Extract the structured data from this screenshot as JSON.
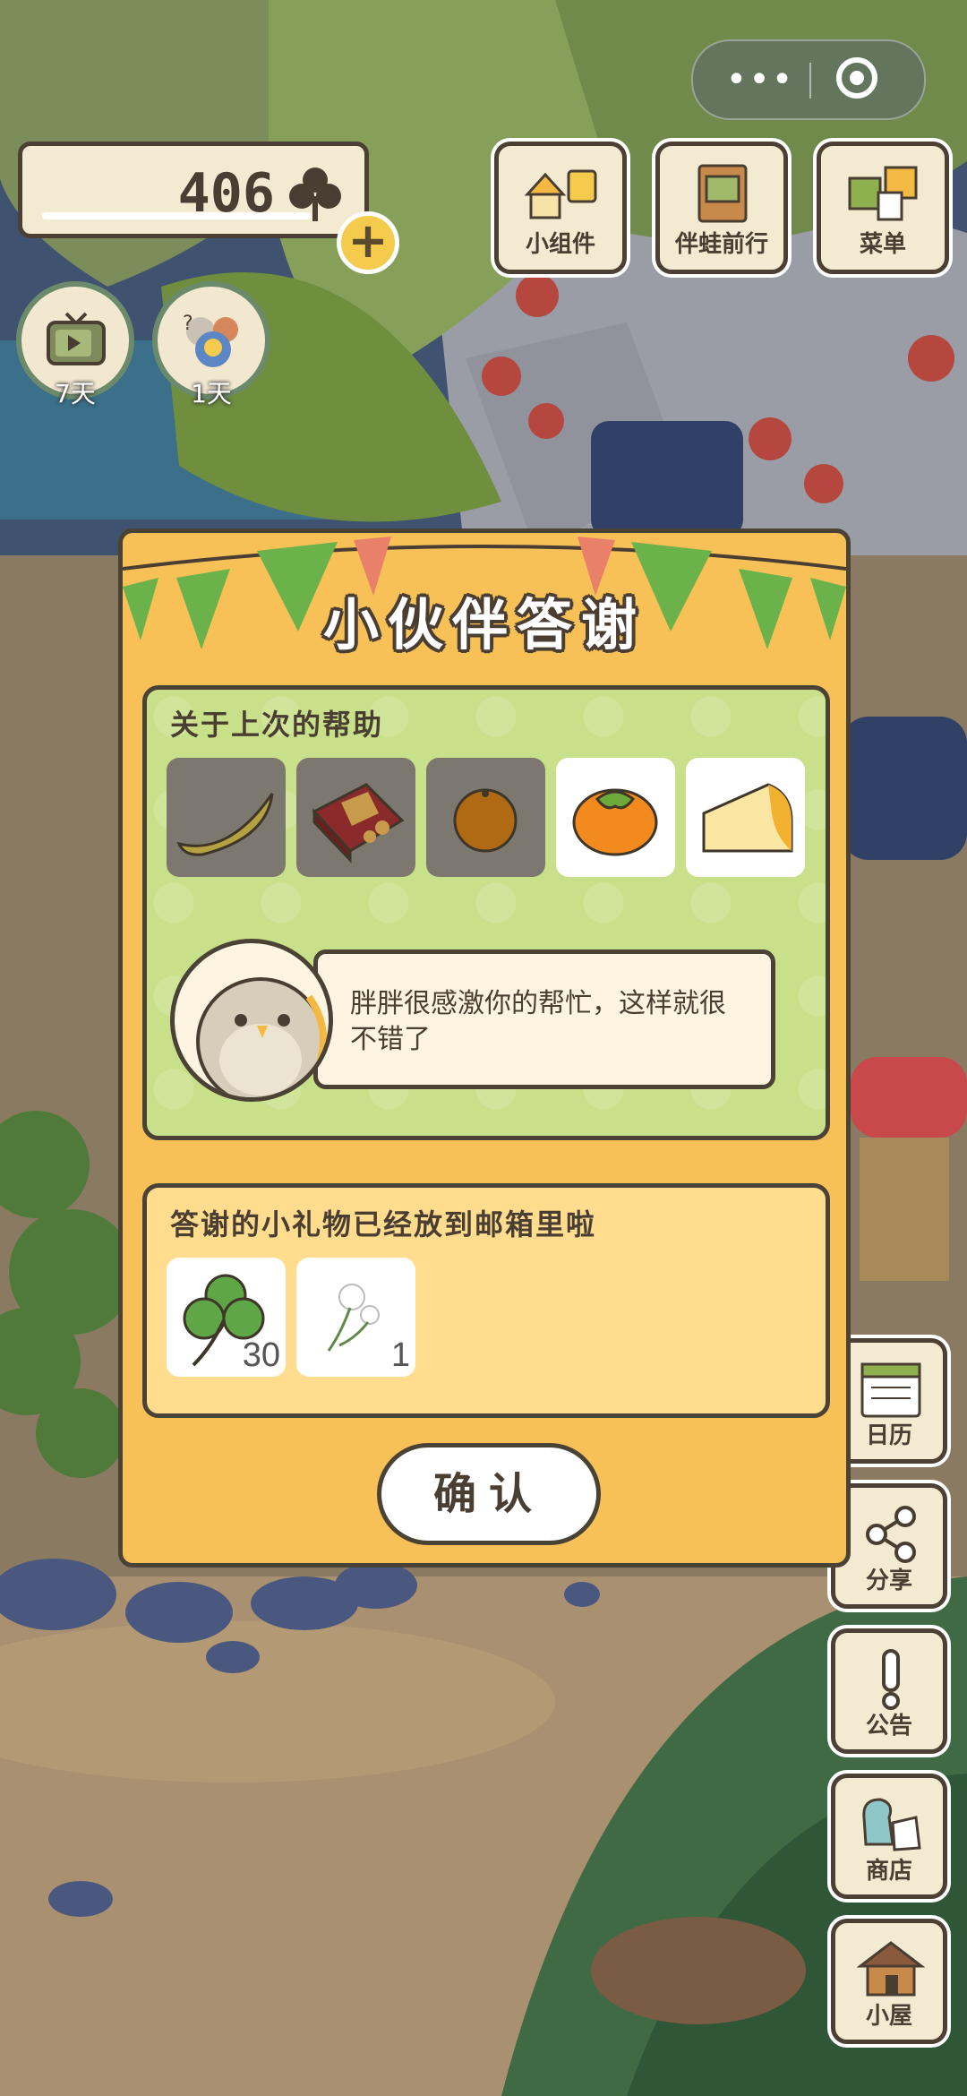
{
  "currency": {
    "amount": "406"
  },
  "timers": [
    {
      "name": "tv",
      "label": "7天"
    },
    {
      "name": "guests",
      "label": "1天"
    }
  ],
  "top_menu": [
    {
      "label": "小组件",
      "icon": "widget-icon"
    },
    {
      "label": "伴蛙前行",
      "icon": "journey-book-icon"
    },
    {
      "label": "菜单",
      "icon": "menu-cards-icon"
    }
  ],
  "side_menu": [
    {
      "label": "日历",
      "icon": "calendar-icon"
    },
    {
      "label": "分享",
      "icon": "share-icon"
    },
    {
      "label": "公告",
      "icon": "notice-icon"
    },
    {
      "label": "商店",
      "icon": "shop-bags-icon"
    },
    {
      "label": "小屋",
      "icon": "house-icon"
    }
  ],
  "dialog": {
    "title": "小伙伴答谢",
    "help_section": {
      "title": "关于上次的帮助",
      "items": [
        {
          "name": "banana",
          "icon": "banana-icon",
          "state": "used"
        },
        {
          "name": "snack-box",
          "icon": "snack-box-icon",
          "state": "used"
        },
        {
          "name": "orange",
          "icon": "orange-icon",
          "state": "used"
        },
        {
          "name": "persimmon",
          "icon": "persimmon-icon",
          "state": "available"
        },
        {
          "name": "cheese",
          "icon": "cheese-icon",
          "state": "available"
        }
      ],
      "message": "胖胖很感激你的帮忙，这样就很不错了"
    },
    "gift_section": {
      "title": "答谢的小礼物已经放到邮箱里啦",
      "items": [
        {
          "name": "clover",
          "icon": "clover-icon",
          "qty": "30"
        },
        {
          "name": "dandelion",
          "icon": "dandelion-icon",
          "qty": "1"
        }
      ]
    },
    "confirm_label": "确认"
  },
  "colors": {
    "dialog_bg": "#f7c158",
    "help_panel_bg": "#c8e08a",
    "gift_panel_bg": "#ffdc8e",
    "outline": "#4a4234"
  }
}
